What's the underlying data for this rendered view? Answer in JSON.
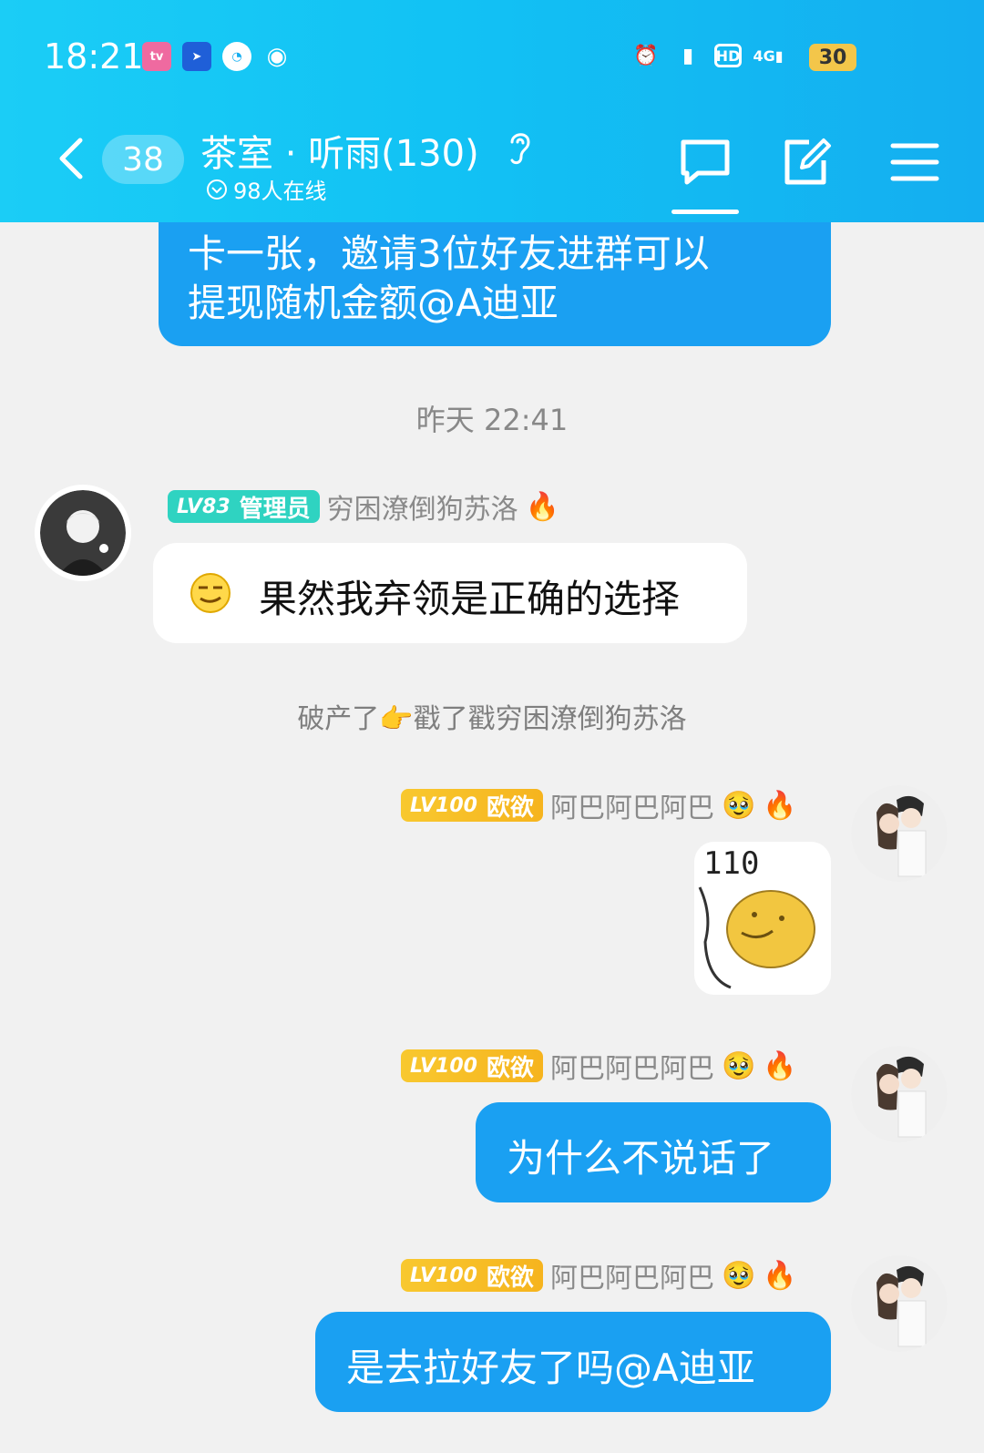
{
  "status_bar": {
    "time": "18:21",
    "apps": [
      "bilibili-icon",
      "feishu-icon",
      "speed-icon",
      "wechat-icon"
    ],
    "indicators": [
      "alarm-icon",
      "vibrate-icon",
      "hd-icon",
      "signal-4g-icon"
    ],
    "hd": "HD",
    "net": "4G",
    "battery": "30"
  },
  "header": {
    "unread_count": "38",
    "group_name": "茶室 · 听雨(130)",
    "online": "98人在线",
    "colors": {
      "start": "#1bcdf6",
      "end": "#14aef0"
    }
  },
  "messages": {
    "partial": {
      "line1": "卡一张，邀请3位好友进群可以",
      "line2": "提现随机金额@A迪亚"
    },
    "time_sep": "昨天 22:41",
    "admin_msg": {
      "badge_level": "LV83",
      "badge_role": "管理员",
      "name": "穷困潦倒狗苏洛",
      "text": "果然我弃领是正确的选择"
    },
    "system": {
      "prefix": "破产了",
      "middle": "戳了戳",
      "target": "穷困潦倒狗苏洛"
    },
    "sender": {
      "badge_level": "LV100",
      "badge_role": "欧欲",
      "name": "阿巴阿巴阿巴"
    },
    "sticker_text": "110",
    "msg2": "为什么不说话了",
    "msg3": "是去拉好友了吗@A迪亚"
  },
  "colors": {
    "blue_bubble": "#1aa0f2",
    "bg": "#f1f1f1",
    "badge_green": "#2fd3c1",
    "badge_gold": "#f8c82f"
  }
}
